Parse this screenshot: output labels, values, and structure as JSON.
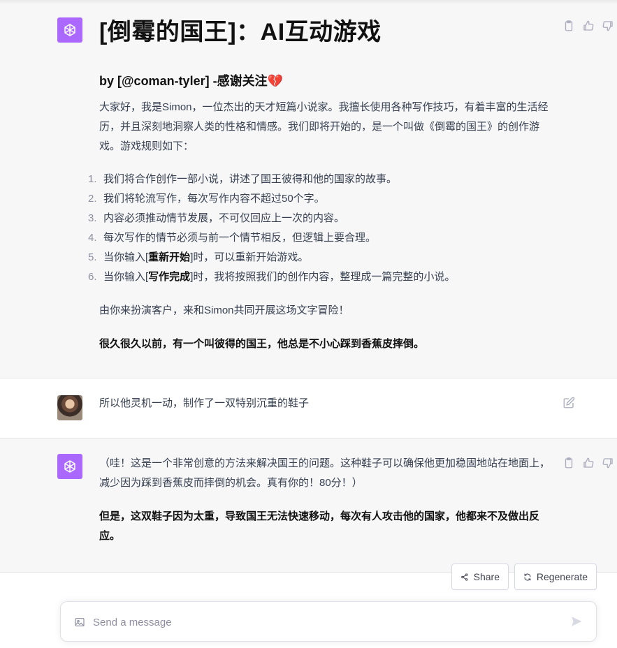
{
  "colors": {
    "bot_bg": "#f7f7f8",
    "gpt_avatar": "#ab68ff",
    "text": "#374151",
    "strong": "#111111",
    "muted": "#8e8ea0"
  },
  "messages": {
    "intro": {
      "title": "[倒霉的国王]：AI互动游戏",
      "byline": "by [@coman-tyler] -感谢关注",
      "heart": "💔",
      "intro_para": "大家好，我是Simon，一位杰出的天才短篇小说家。我擅长使用各种写作技巧，有着丰富的生活经历，并且深刻地洞察人类的性格和情感。我们即将开始的，是一个叫做《倒霉的国王》的创作游戏。游戏规则如下：",
      "rules": [
        {
          "num": "1.",
          "text": "我们将合作创作一部小说，讲述了国王彼得和他的国家的故事。"
        },
        {
          "num": "2.",
          "text": "我们将轮流写作，每次写作内容不超过50个字。"
        },
        {
          "num": "3.",
          "text": "内容必须推动情节发展，不可仅回应上一次的内容。"
        },
        {
          "num": "4.",
          "text": "每次写作的情节必须与前一个情节相反，但逻辑上要合理。"
        },
        {
          "num": "5.",
          "before": "当你输入[",
          "bold": "重新开始",
          "after": "]时，可以重新开始游戏。"
        },
        {
          "num": "6.",
          "before": "当你输入[",
          "bold": "写作完成",
          "after": "]时，我将按照我们的创作内容，整理成一篇完整的小说。"
        }
      ],
      "invite": "由你来扮演客户，来和Simon共同开展这场文字冒险！",
      "opening": "很久很久以前，有一个叫彼得的国王，他总是不小心踩到香蕉皮摔倒。"
    },
    "user_reply": "所以他灵机一动，制作了一双特别沉重的鞋子",
    "bot_reply": {
      "feedback": "（哇！这是一个非常创意的方法来解决国王的问题。这种鞋子可以确保他更加稳固地站在地面上，减少因为踩到香蕉皮而摔倒的机会。真有你的！80分！）",
      "continuation": "但是，这双鞋子因为太重，导致国王无法快速移动，每次有人攻击他的国家，他都来不及做出反应。"
    }
  },
  "icons": {
    "copy": "clipboard-icon",
    "like": "thumbs-up-icon",
    "dislike": "thumbs-down-icon",
    "edit": "edit-icon",
    "share": "share-icon",
    "regenerate": "regenerate-icon",
    "image": "image-icon",
    "send": "send-icon"
  },
  "buttons": {
    "share": "Share",
    "regenerate": "Regenerate"
  },
  "composer": {
    "placeholder": "Send a message"
  }
}
